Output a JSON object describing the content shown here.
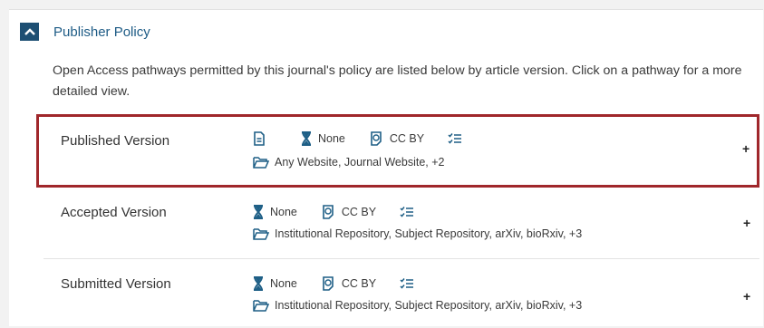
{
  "policy": {
    "title": "Publisher Policy",
    "intro": "Open Access pathways permitted by this journal's policy are listed below by article version. Click on a pathway for a more detailed view."
  },
  "pathways": [
    {
      "version": "Published Version",
      "embargo": "None",
      "license": "CC BY",
      "locations": "Any Website, Journal Website, +2",
      "expand": "+"
    },
    {
      "version": "Accepted Version",
      "embargo": "None",
      "license": "CC BY",
      "locations": "Institutional Repository, Subject Repository, arXiv, bioRxiv, +3",
      "expand": "+"
    },
    {
      "version": "Submitted Version",
      "embargo": "None",
      "license": "CC BY",
      "locations": "Institutional Repository, Subject Repository, arXiv, bioRxiv, +3",
      "expand": "+"
    }
  ],
  "colors": {
    "accent": "#1d5b85",
    "highlight_border": "#a0272b",
    "icon": "#1e5f86"
  },
  "icons": [
    "chevron-up-icon",
    "document-icon",
    "hourglass-icon",
    "cc-license-icon",
    "checklist-icon",
    "folder-icon",
    "plus-icon"
  ]
}
